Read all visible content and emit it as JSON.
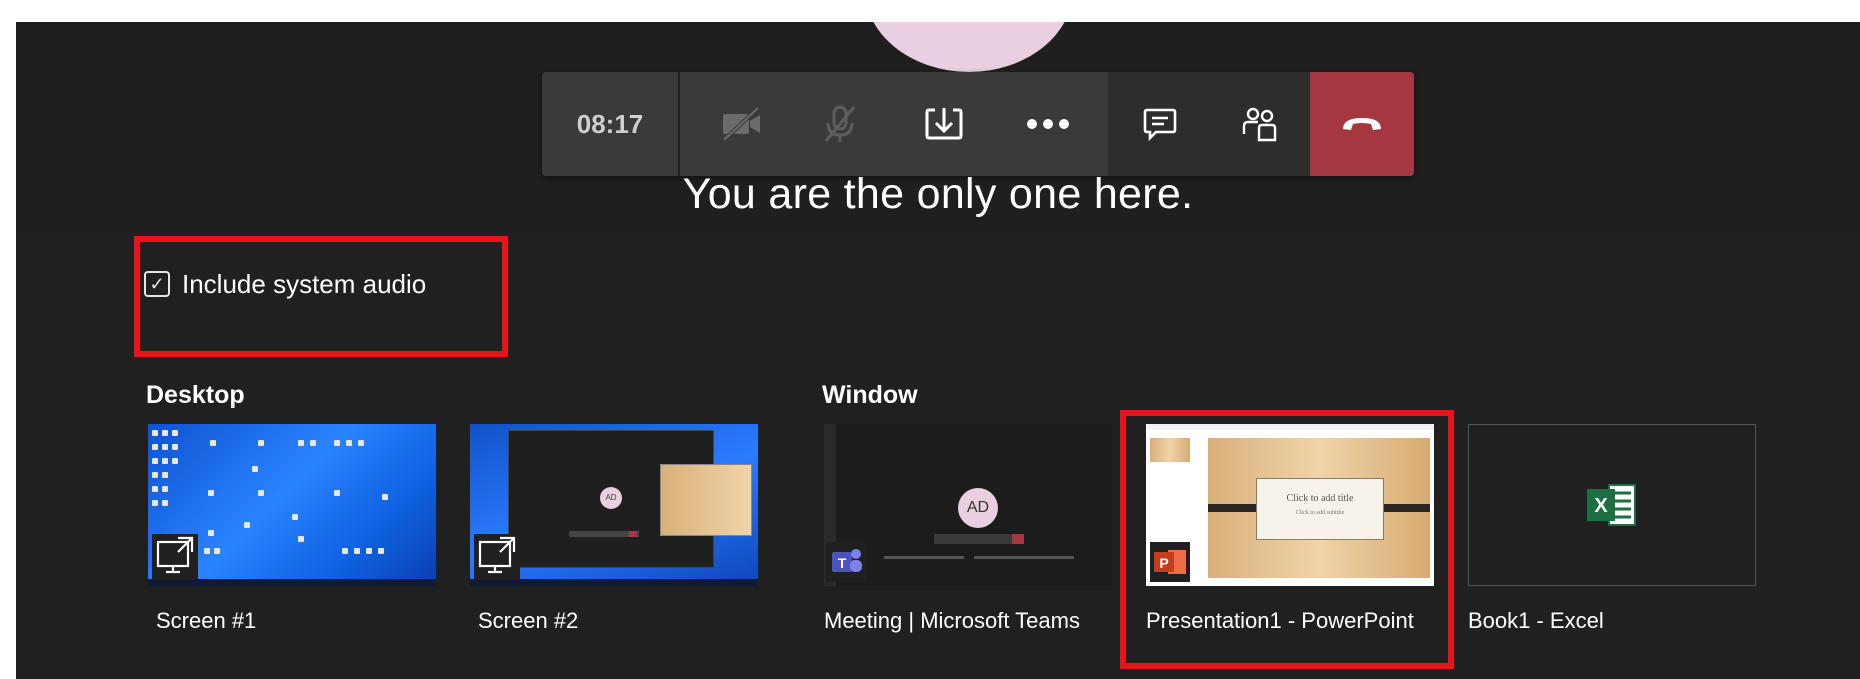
{
  "call": {
    "timer": "08:17",
    "status_message": "You are the only one here."
  },
  "controls": {
    "camera_icon": "video-off-icon",
    "mic_icon": "mic-off-icon",
    "share_icon": "share-tray-icon",
    "more_icon": "more-options-icon",
    "chat_icon": "chat-icon",
    "participants_icon": "participants-icon",
    "hangup_icon": "hang-up-icon",
    "hangup_color": "#a4373f"
  },
  "share_tray": {
    "include_audio": {
      "label": "Include system audio",
      "checked": true
    },
    "desktop_title": "Desktop",
    "window_title": "Window",
    "desktops": [
      {
        "label": "Screen #1"
      },
      {
        "label": "Screen #2"
      }
    ],
    "windows": [
      {
        "label": "Meeting | Microsoft Teams",
        "app_icon": "teams-icon"
      },
      {
        "label": "Presentation1 - PowerPoint",
        "app_icon": "powerpoint-icon"
      },
      {
        "label": "Book1 - Excel",
        "app_icon": "excel-icon"
      }
    ],
    "thumbnails": {
      "teams_avatar_initials": "AD",
      "slide_title": "Click to add title",
      "slide_subtitle": "Click to add subtitle"
    }
  },
  "colors": {
    "accent_red_box": "#e8141b",
    "background": "#1f1f1f"
  }
}
